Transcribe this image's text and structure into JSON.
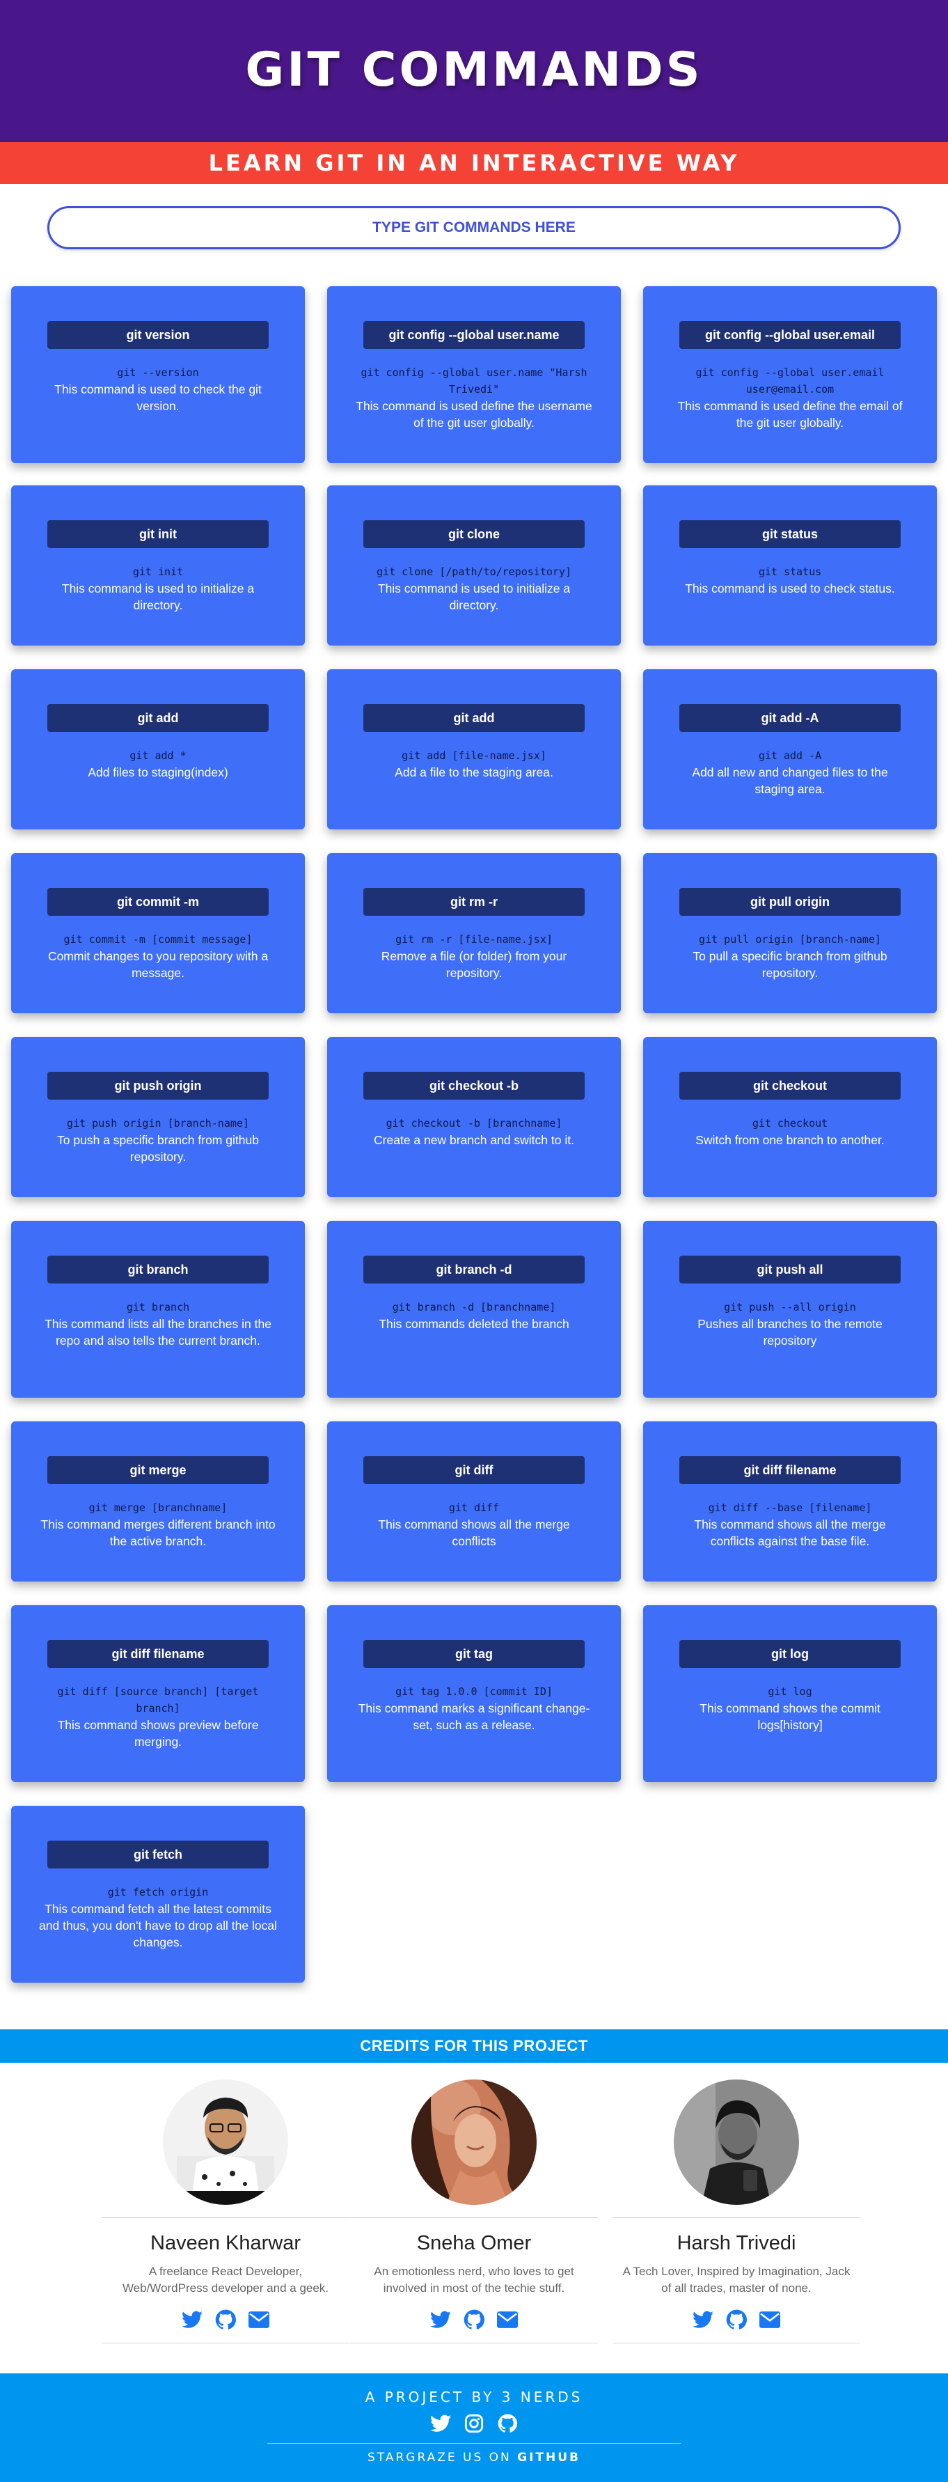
{
  "header": {
    "title": "GIT COMMANDS",
    "subtitle": "LEARN GIT IN AN INTERACTIVE WAY"
  },
  "search": {
    "placeholder": "TYPE GIT COMMANDS HERE",
    "value": ""
  },
  "cards": [
    {
      "title": "git version",
      "command": "git --version",
      "description": "This command is used to check the git version."
    },
    {
      "title": "git config --global user.name",
      "command": "git config --global user.name \"Harsh Trivedi\"",
      "description": "This command is used define the username of the git user globally."
    },
    {
      "title": "git config --global user.email",
      "command": "git config --global user.email user@email.com",
      "description": "This command is used define the email of the git user globally."
    },
    {
      "title": "git init",
      "command": "git init",
      "description": "This command is used to initialize a directory."
    },
    {
      "title": "git clone",
      "command": "git clone [/path/to/repository]",
      "description": "This command is used to initialize a directory."
    },
    {
      "title": "git status",
      "command": "git status",
      "description": "This command is used to check status."
    },
    {
      "title": "git add",
      "command": "git add *",
      "description": "Add files to staging(index)"
    },
    {
      "title": "git add",
      "command": "git add [file-name.jsx]",
      "description": "Add a file to the staging area."
    },
    {
      "title": "git add -A",
      "command": "git add -A",
      "description": "Add all new and changed files to the staging area."
    },
    {
      "title": "git commit -m",
      "command": "git commit -m [commit message]",
      "description": "Commit changes to you repository with a message."
    },
    {
      "title": "git rm -r",
      "command": "git rm -r [file-name.jsx]",
      "description": "Remove a file (or folder) from your repository."
    },
    {
      "title": "git pull origin",
      "command": "git pull origin [branch-name]",
      "description": "To pull a specific branch from github repository."
    },
    {
      "title": "git push origin",
      "command": "git push origin [branch-name]",
      "description": "To push a specific branch from github repository."
    },
    {
      "title": "git checkout -b",
      "command": "git checkout -b [branchname]",
      "description": "Create a new branch and switch to it."
    },
    {
      "title": "git checkout",
      "command": "git checkout",
      "description": "Switch from one branch to another."
    },
    {
      "title": "git branch",
      "command": "git branch",
      "description": "This command lists all the branches in the repo and also tells the current branch."
    },
    {
      "title": "git branch -d",
      "command": "git branch -d [branchname]",
      "description": "This commands deleted the branch"
    },
    {
      "title": "git push all",
      "command": "git push --all origin",
      "description": "Pushes all branches to the remote repository"
    },
    {
      "title": "git merge",
      "command": "git merge [branchname]",
      "description": "This command merges different branch into the active branch."
    },
    {
      "title": "git diff",
      "command": "git diff",
      "description": "This command shows all the merge conflicts"
    },
    {
      "title": "git diff filename",
      "command": "git diff --base [filename]",
      "description": "This command shows all the merge conflicts against the base file."
    },
    {
      "title": "git diff filename",
      "command": "git diff [source branch] [target branch]",
      "description": "This command shows preview before merging."
    },
    {
      "title": "git tag",
      "command": "git tag 1.0.0 [commit ID]",
      "description": "This command marks a significant change-set, such as a release."
    },
    {
      "title": "git log",
      "command": "git log",
      "description": "This command shows the commit logs[history]"
    },
    {
      "title": "git fetch",
      "command": "git fetch origin",
      "description": "This command fetch all the latest commits and thus, you don't have to drop all the local changes."
    }
  ],
  "credits": {
    "title": "CREDITS FOR THIS PROJECT",
    "people": [
      {
        "name": "Naveen Kharwar",
        "bio": "A freelance React Developer, Web/WordPress developer and a geek.",
        "icons": [
          "twitter-icon",
          "github-icon",
          "mail-icon"
        ]
      },
      {
        "name": "Sneha Omer",
        "bio": "An emotionless nerd, who loves to get involved in most of the techie stuff.",
        "icons": [
          "twitter-icon",
          "github-icon",
          "mail-icon"
        ]
      },
      {
        "name": "Harsh Trivedi",
        "bio": "A Tech Lover, Inspired by Imagination, Jack of all trades, master of none.",
        "icons": [
          "twitter-icon",
          "github-icon",
          "mail-icon"
        ]
      }
    ]
  },
  "footer": {
    "project_text": "A PROJECT BY 3 NERDS",
    "icons": [
      "twitter-icon",
      "instagram-icon",
      "github-icon"
    ],
    "stargaze_text": "STARGRAZE US ON",
    "stargaze_link": "GITHUB"
  },
  "colors": {
    "hero": "#4a178a",
    "subband": "#f44336",
    "card": "#3f6ef8",
    "card_tag": "#1f3175",
    "accent_blue": "#0096f0",
    "icon_blue": "#1877f2",
    "search_border": "#3f51d6"
  }
}
